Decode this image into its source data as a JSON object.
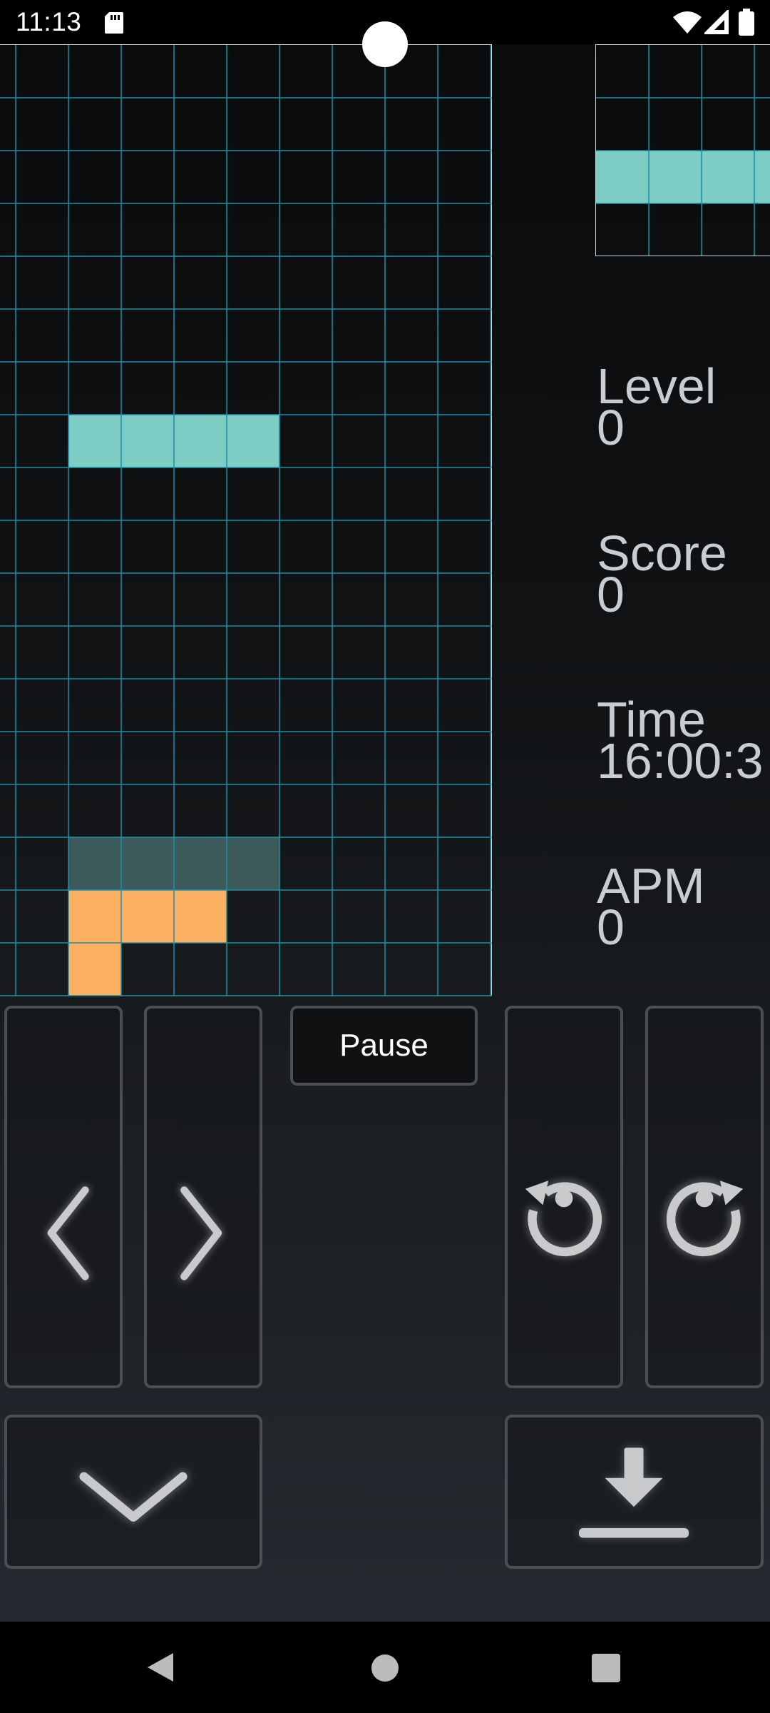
{
  "status_bar": {
    "time": "11:13",
    "icons": [
      "sd-card-icon",
      "wifi-icon",
      "signal-icon",
      "battery-icon"
    ]
  },
  "board": {
    "columns": 10,
    "rows": 18,
    "active_piece": {
      "shape": "I",
      "color": "#7ecdc4",
      "cells": [
        [
          2,
          7
        ],
        [
          3,
          7
        ],
        [
          4,
          7
        ],
        [
          5,
          7
        ]
      ]
    },
    "ghost_piece": {
      "color": "#3d5a5a",
      "cells": [
        [
          2,
          15
        ],
        [
          3,
          15
        ],
        [
          4,
          15
        ],
        [
          5,
          15
        ]
      ]
    },
    "locked_cells": {
      "color": "#fbb062",
      "cells": [
        [
          2,
          16
        ],
        [
          3,
          16
        ],
        [
          4,
          16
        ],
        [
          2,
          17
        ]
      ]
    },
    "grid_color": "#1d8fa8"
  },
  "next_piece": {
    "shape": "I",
    "color": "#7ecdc4"
  },
  "stats": {
    "level_label": "Level",
    "level_value": "0",
    "score_label": "Score",
    "score_value": "0",
    "time_label": "Time",
    "time_value": "16:00:3",
    "apm_label": "APM",
    "apm_value": "0"
  },
  "controls": {
    "pause_label": "Pause",
    "buttons": [
      "move-left",
      "move-right",
      "rotate-counterclockwise",
      "rotate-clockwise",
      "soft-drop",
      "hard-drop"
    ]
  },
  "nav_bar": {
    "icons": [
      "back-icon",
      "home-icon",
      "recents-icon"
    ]
  }
}
